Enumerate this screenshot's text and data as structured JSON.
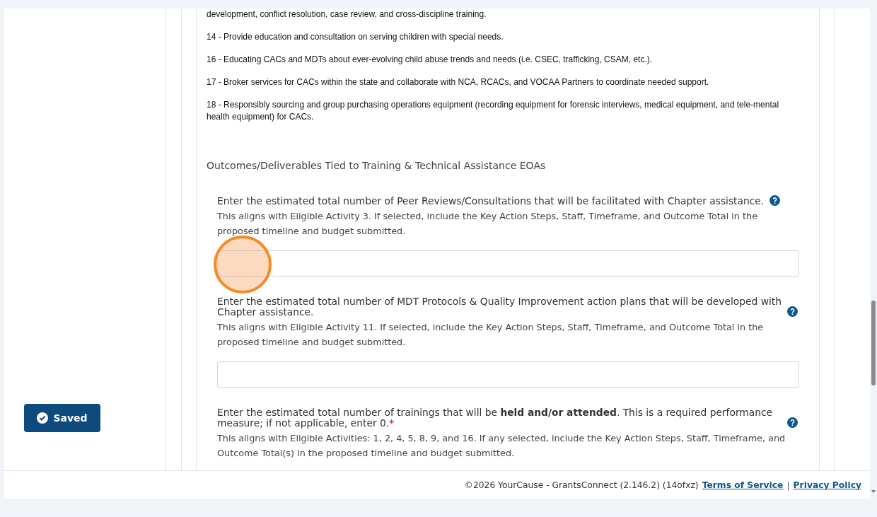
{
  "activities": [
    "development, conflict resolution, case review, and cross-discipline training.",
    "14  - Provide education and consultation on serving children with special needs.",
    "16 - Educating CACs and MDTs about ever-evolving child abuse trends and needs (i.e. CSEC, trafficking, CSAM, etc.).",
    "17 - Broker services for CACs within the state and collaborate with NCA, RCACs, and VOCAA Partners to coordinate needed support.",
    "18 - Responsibly sourcing and group purchasing operations equipment (recording equipment for forensic interviews, medical equipment, and tele-mental health equipment) for CACs."
  ],
  "section_title": "Outcomes/Deliverables Tied to Training & Technical Assistance EOAs",
  "questions": [
    {
      "text": "Enter the estimated total number of Peer Reviews/Consultations that will be facilitated with Chapter assistance.",
      "required": false,
      "help": true,
      "hint": "This aligns with Eligible Activity 3. If selected, include the Key Action Steps, Staff, Timeframe, and Outcome Total in the proposed timeline and budget submitted.",
      "field": true
    },
    {
      "text": "Enter the estimated total number of MDT Protocols & Quality Improvement action plans that will be developed with Chapter assistance.",
      "required": false,
      "help": true,
      "hint": "This aligns with Eligible Activity 11. If selected, include the Key Action Steps, Staff, Timeframe, and Outcome Total in the proposed timeline and budget submitted.",
      "field": true
    },
    {
      "text": "Enter the estimated total number of trainings that will be **held and/or attended**. This is a required performance measure; if not applicable, enter 0.",
      "required": true,
      "help": true,
      "hint": "This aligns with Eligible Activities: 1, 2, 4, 5, 8, 9, and 16. If any selected, include the Key Action Steps, Staff, Timeframe, and Outcome Total(s) in the proposed timeline and budget submitted.",
      "field": false
    }
  ],
  "required_marker": "*",
  "save_button": {
    "label": "Saved"
  },
  "footer": {
    "copyright": "©2026 YourCause - GrantsConnect (2.146.2) (14ofxz)",
    "links": [
      "Terms of Service",
      "Privacy Policy"
    ],
    "separator": "|"
  }
}
